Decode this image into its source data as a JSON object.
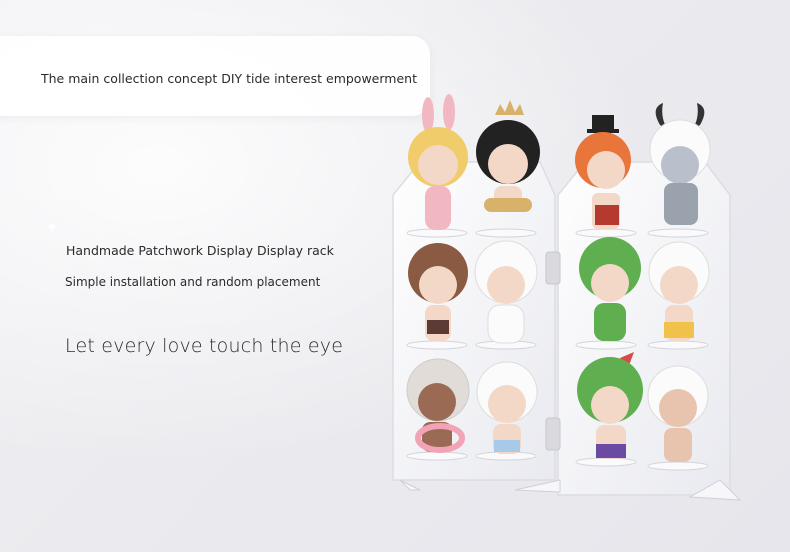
{
  "header": {
    "tagline": "The main collection concept DIY tide interest empowerment"
  },
  "content": {
    "line1": "Handmade Patchwork Display Display rack",
    "line2": "Simple installation and random placement",
    "line3": "Let every love touch the eye"
  },
  "product": {
    "figure_names": [
      "bunny-ears-figure",
      "crown-figure",
      "top-hat-figure",
      "horned-figure",
      "bear-hood-figure",
      "cloud-hair-figure",
      "green-dragon-figure",
      "white-goat-figure",
      "flamingo-float-figure",
      "white-curly-figure",
      "watermelon-hat-figure",
      "horned-pink-figure"
    ],
    "colors": {
      "acrylic": "#f4f5f8",
      "skin": "#f3d8c8",
      "bunny_pink": "#f2b8c2",
      "crown_gold": "#d8b26a",
      "hair_orange": "#e8753a",
      "green": "#5fae4f",
      "white": "#fbfbfb"
    }
  }
}
